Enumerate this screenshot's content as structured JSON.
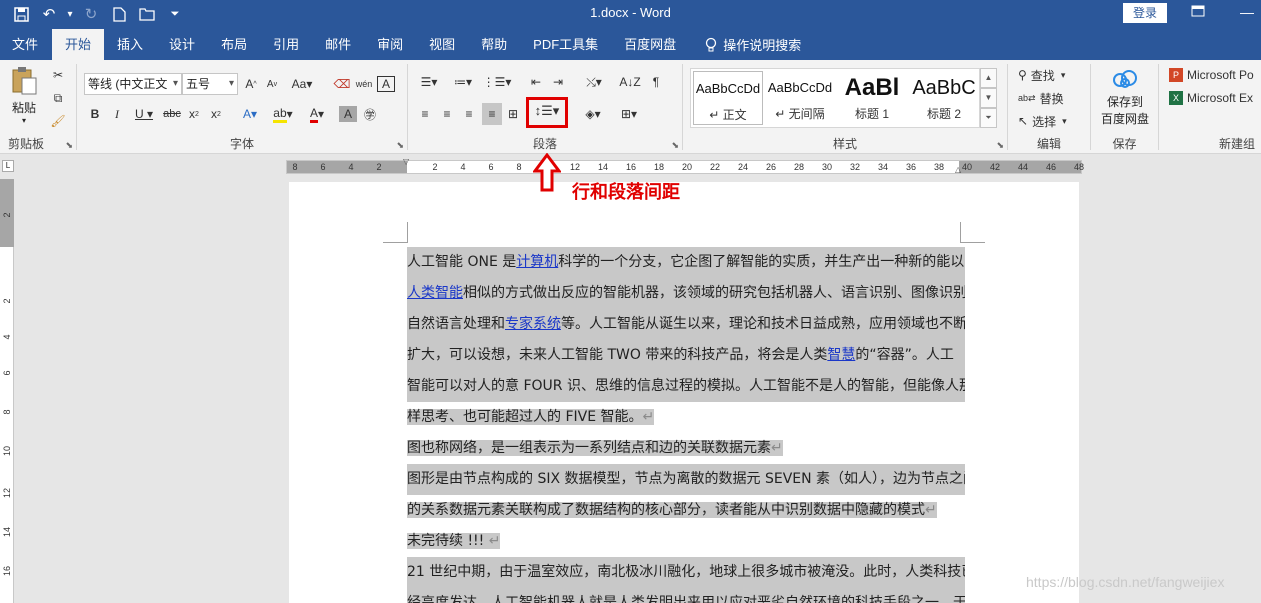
{
  "titlebar": {
    "doc_title": "1.docx - Word",
    "login": "登录"
  },
  "tabs": [
    "文件",
    "开始",
    "插入",
    "设计",
    "布局",
    "引用",
    "邮件",
    "审阅",
    "视图",
    "帮助",
    "PDF工具集",
    "百度网盘"
  ],
  "tell_me": "操作说明搜索",
  "clipboard": {
    "paste": "粘贴",
    "label": "剪贴板"
  },
  "font": {
    "name": "等线 (中文正文",
    "size": "五号",
    "label": "字体"
  },
  "paragraph": {
    "label": "段落"
  },
  "styles": {
    "label": "样式",
    "items": [
      {
        "preview": "AaBbCcDd",
        "name": "↵ 正文"
      },
      {
        "preview": "AaBbCcDd",
        "name": "↵ 无间隔"
      },
      {
        "preview": "AaBl",
        "name": "标题 1"
      },
      {
        "preview": "AaBbC",
        "name": "标题 2"
      }
    ]
  },
  "editing": {
    "find": "查找",
    "replace": "替换",
    "select": "选择",
    "label": "编辑"
  },
  "save": {
    "line1": "保存到",
    "line2": "百度网盘",
    "label": "保存"
  },
  "newgroup": {
    "ms1": "Microsoft Po",
    "ms2": "Microsoft Ex",
    "label": "新建组"
  },
  "ruler": {
    "ticks": [
      "8",
      "6",
      "4",
      "2",
      "",
      "2",
      "4",
      "6",
      "8",
      "10",
      "12",
      "14",
      "16",
      "18",
      "20",
      "22",
      "24",
      "26",
      "28",
      "30",
      "32",
      "34",
      "36",
      "38",
      "40",
      "42",
      "44",
      "46",
      "48"
    ]
  },
  "vruler": {
    "ticks": [
      "2",
      "2",
      "4",
      "6",
      "8",
      "10",
      "12",
      "14",
      "16"
    ]
  },
  "annotation": {
    "text": "行和段落间距"
  },
  "document": {
    "lines": [
      [
        {
          "t": "人工智能 ONE 是"
        },
        {
          "t": "计算机",
          "link": true
        },
        {
          "t": "科学的一个分支，它企图了解智能的实质，并生产出一种新的能以"
        }
      ],
      [
        {
          "t": "人类智能",
          "link": true
        },
        {
          "t": "相似的方式做出反应的智能机器，该领域的研究包括机器人、语言识别、图像识别、"
        }
      ],
      [
        {
          "t": "自然语言处理和"
        },
        {
          "t": "专家系统",
          "link": true
        },
        {
          "t": "等。人工智能从诞生以来，理论和技术日益成熟，应用领域也不断"
        }
      ],
      [
        {
          "t": "扩大，可以设想，未来人工智能 TWO 带来的科技产品，将会是人类"
        },
        {
          "t": "智慧",
          "link": true
        },
        {
          "t": "的“容器”。人工"
        }
      ],
      [
        {
          "t": "智能可以对人的意 FOUR 识、思维的信息过程的模拟。人工智能不是人的智能，但能像人那"
        }
      ],
      [
        {
          "t": "样思考、也可能超过人的 FIVE 智能。"
        },
        {
          "t": "↵",
          "mark": true
        }
      ],
      [
        {
          "t": "图也称网络，是一组表示为一系列结点和边的关联数据元素"
        },
        {
          "t": "↵",
          "mark": true
        }
      ],
      [
        {
          "t": "图形是由节点构成的 SIX 数据模型，节点为离散的数据元 SEVEN 素（如人），边为节点之间"
        }
      ],
      [
        {
          "t": "的关系数据元素关联构成了数据结构的核心部分，读者能从中识别数据中隐藏的模式"
        },
        {
          "t": "↵",
          "mark": true
        }
      ],
      [
        {
          "t": "未完待续 !!! "
        },
        {
          "t": "↵",
          "mark": true
        }
      ],
      [
        {
          "t": "21 世纪中期，由于温室效应，南北极冰川融化，地球上很多城市被淹没。此时，人类科技已"
        }
      ],
      [
        {
          "t": "经高度发达，人工智能机器人就是人类发明出来用以应对恶劣自然环境的科技手段之一。于"
        }
      ]
    ]
  },
  "watermark": "https://blog.csdn.net/fangweijiex"
}
